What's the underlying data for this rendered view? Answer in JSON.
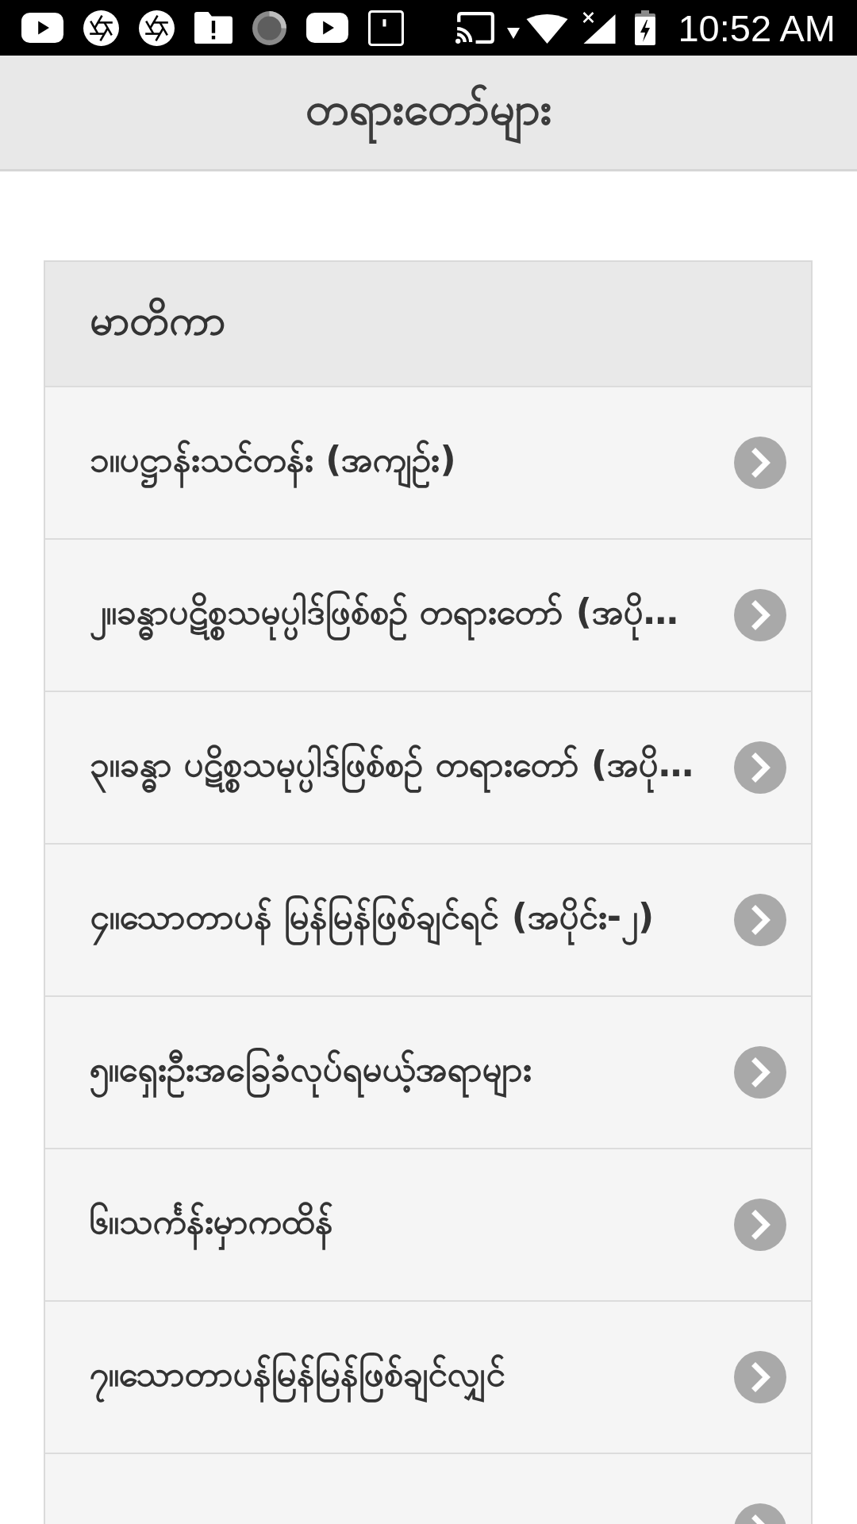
{
  "status_bar": {
    "time": "10:52 AM"
  },
  "app_bar": {
    "title": "တရားတော်များ"
  },
  "contents": {
    "heading": "မာတိကာ",
    "items": [
      {
        "kind": "entry",
        "label": "၁။ပဋ္ဌာန်းသင်တန်း (အကျဉ်း)"
      },
      {
        "kind": "entry",
        "label": "၂။ခန္ဓာပဋိစ္စသမုပ္ပါဒ်ဖြစ်စဉ် တရားတော် (အပို…"
      },
      {
        "kind": "entry",
        "label": "၃။ခန္ဓာ ပဋိစ္စသမုပ္ပါဒ်ဖြစ်စဉ် တရားတော် (အပို…"
      },
      {
        "kind": "entry",
        "label": "၄။သောတာပန် မြန်မြန်ဖြစ်ချင်ရင် (အပိုင်း-၂)"
      },
      {
        "kind": "entry",
        "label": "၅။ရှေးဦးအခြေခံလုပ်ရမယ့်အရာများ"
      },
      {
        "kind": "entry",
        "label": "၆။သင်္ကန်းမှာကထိန်"
      },
      {
        "kind": "entry",
        "label": "၇။သောတာပန်မြန်မြန်ဖြစ်ချင်လျှင်"
      },
      {
        "kind": "clipped"
      }
    ]
  }
}
